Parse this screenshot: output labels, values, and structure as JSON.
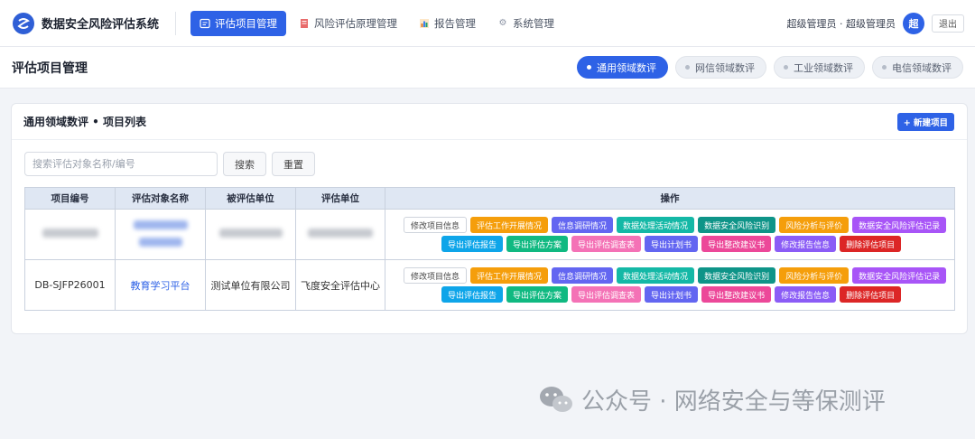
{
  "app": {
    "title": "数据安全风险评估系统"
  },
  "nav": [
    {
      "label": "评估项目管理",
      "icon": "doc-icon",
      "active": true
    },
    {
      "label": "风险评估原理管理",
      "icon": "book-icon",
      "active": false
    },
    {
      "label": "报告管理",
      "icon": "bar-chart-icon",
      "active": false
    },
    {
      "label": "系统管理",
      "icon": "gear-icon",
      "active": false
    }
  ],
  "user": {
    "label": "超级管理员 · 超级管理员",
    "avatar_text": "超",
    "logout": "退出"
  },
  "page": {
    "title": "评估项目管理"
  },
  "domain_tabs": [
    "通用领域数评",
    "网信领域数评",
    "工业领域数评",
    "电信领域数评"
  ],
  "card": {
    "title": "通用领域数评 • 项目列表",
    "new_button": "+ 新建项目"
  },
  "search": {
    "placeholder": "搜索评估对象名称/编号",
    "search_button": "搜索",
    "reset_button": "重置"
  },
  "table": {
    "headers": [
      "项目编号",
      "评估对象名称",
      "被评估单位",
      "评估单位",
      "操作"
    ],
    "rows": [
      {
        "id": "",
        "object": "",
        "unit": "",
        "evaluator": ""
      },
      {
        "id": "DB-SJFP26001",
        "object": "教育学习平台",
        "unit": "测试单位有限公司",
        "evaluator": "飞度安全评估中心"
      }
    ]
  },
  "operations": {
    "line1": [
      {
        "label": "修改项目信息",
        "color": "#ffffff"
      },
      {
        "label": "评估工作开展情况",
        "color": "#f59e0b"
      },
      {
        "label": "信息调研情况",
        "color": "#6366f1"
      },
      {
        "label": "数据处理活动情况",
        "color": "#14b8a6"
      },
      {
        "label": "数据安全风险识别",
        "color": "#0e9488"
      },
      {
        "label": "风险分析与评价",
        "color": "#f59e0b"
      },
      {
        "label": "数据安全风险评估记录",
        "color": "#a855f7"
      }
    ],
    "line2": [
      {
        "label": "导出评估报告",
        "color": "#0ea5e9"
      },
      {
        "label": "导出评估方案",
        "color": "#10b981"
      },
      {
        "label": "导出评估调查表",
        "color": "#f472b6"
      },
      {
        "label": "导出计划书",
        "color": "#6366f1"
      },
      {
        "label": "导出整改建议书",
        "color": "#ec4899"
      },
      {
        "label": "修改报告信息",
        "color": "#8b5cf6"
      },
      {
        "label": "删除评估项目",
        "color": "#dc2626"
      }
    ]
  },
  "watermark": {
    "text": "公众号 · 网络安全与等保测评"
  }
}
